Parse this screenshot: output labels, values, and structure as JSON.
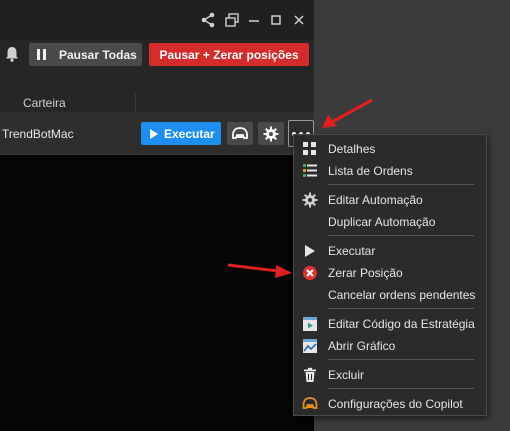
{
  "toolbar": {
    "pause_all_label": "Pausar Todas",
    "pause_reset_label": "Pausar + Zerar posições"
  },
  "columns": {
    "portfolio_header": "Carteira"
  },
  "row": {
    "name": "TrendBotMac",
    "execute_label": "Executar"
  },
  "menu": {
    "items": [
      {
        "label": "Detalhes",
        "icon": "dots-grid-icon"
      },
      {
        "label": "Lista de Ordens",
        "icon": "order-list-icon"
      },
      {
        "label": "Editar Automação",
        "icon": "gear-icon"
      },
      {
        "label": "Duplicar Automação",
        "icon": ""
      },
      {
        "label": "Executar",
        "icon": "play-icon"
      },
      {
        "label": "Zerar Posição",
        "icon": "red-x-icon"
      },
      {
        "label": "Cancelar ordens pendentes",
        "icon": ""
      },
      {
        "label": "Editar Código da Estratégia",
        "icon": "code-editor-icon"
      },
      {
        "label": "Abrir Gráfico",
        "icon": "chart-icon"
      },
      {
        "label": "Excluir",
        "icon": "trash-icon"
      },
      {
        "label": "Configurações do Copilot",
        "icon": "copilot-icon"
      }
    ]
  },
  "colors": {
    "accent_blue": "#1e8ff0",
    "danger_red": "#d42b2b",
    "annotation_arrow": "#e02020"
  }
}
